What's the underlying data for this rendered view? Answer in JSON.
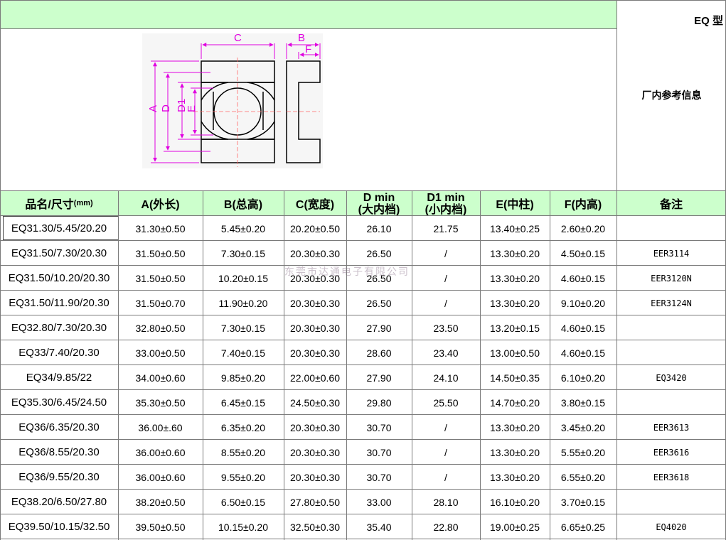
{
  "title": "EQ 型",
  "reference_info": "厂内参考信息",
  "diagram": {
    "labels": {
      "a": "A",
      "b": "B",
      "c": "C",
      "d": "D",
      "d1": "D1",
      "e": "E",
      "f": "F"
    },
    "colors": {
      "dimension": "#e000e0",
      "outline": "#000000",
      "background": "#f6f6f6",
      "centerline": "#ff6666"
    }
  },
  "columns": [
    {
      "label": "品名/尺寸",
      "unit": "(mm)"
    },
    {
      "label": "A(外长)"
    },
    {
      "label": "B(总高)"
    },
    {
      "label": "C(宽度)"
    },
    {
      "label": "D min",
      "sub": "(大内档)"
    },
    {
      "label": "D1 min",
      "sub": "(小内档)"
    },
    {
      "label": "E(中柱)"
    },
    {
      "label": "F(内高)"
    },
    {
      "label": "备注"
    }
  ],
  "rows": [
    [
      "EQ31.30/5.45/20.20",
      "31.30±0.50",
      "5.45±0.20",
      "20.20±0.50",
      "26.10",
      "21.75",
      "13.40±0.25",
      "2.60±0.20",
      ""
    ],
    [
      "EQ31.50/7.30/20.30",
      "31.50±0.50",
      "7.30±0.15",
      "20.30±0.30",
      "26.50",
      "/",
      "13.30±0.20",
      "4.50±0.15",
      "EER3114"
    ],
    [
      "EQ31.50/10.20/20.30",
      "31.50±0.50",
      "10.20±0.15",
      "20.30±0.30",
      "26.50",
      "/",
      "13.30±0.20",
      "4.60±0.15",
      "EER3120N"
    ],
    [
      "EQ31.50/11.90/20.30",
      "31.50±0.70",
      "11.90±0.20",
      "20.30±0.30",
      "26.50",
      "/",
      "13.30±0.20",
      "9.10±0.20",
      "EER3124N"
    ],
    [
      "EQ32.80/7.30/20.30",
      "32.80±0.50",
      "7.30±0.15",
      "20.30±0.30",
      "27.90",
      "23.50",
      "13.20±0.15",
      "4.60±0.15",
      ""
    ],
    [
      "EQ33/7.40/20.30",
      "33.00±0.50",
      "7.40±0.15",
      "20.30±0.30",
      "28.60",
      "23.40",
      "13.00±0.50",
      "4.60±0.15",
      ""
    ],
    [
      "EQ34/9.85/22",
      "34.00±0.60",
      "9.85±0.20",
      "22.00±0.60",
      "27.90",
      "24.10",
      "14.50±0.35",
      "6.10±0.20",
      "EQ3420"
    ],
    [
      "EQ35.30/6.45/24.50",
      "35.30±0.50",
      "6.45±0.15",
      "24.50±0.30",
      "29.80",
      "25.50",
      "14.70±0.20",
      "3.80±0.15",
      ""
    ],
    [
      "EQ36/6.35/20.30",
      "36.00±.60",
      "6.35±0.20",
      "20.30±0.30",
      "30.70",
      "/",
      "13.30±0.20",
      "3.45±0.20",
      "EER3613"
    ],
    [
      "EQ36/8.55/20.30",
      "36.00±0.60",
      "8.55±0.20",
      "20.30±0.30",
      "30.70",
      "/",
      "13.30±0.20",
      "5.55±0.20",
      "EER3616"
    ],
    [
      "EQ36/9.55/20.30",
      "36.00±0.60",
      "9.55±0.20",
      "20.30±0.30",
      "30.70",
      "/",
      "13.30±0.20",
      "6.55±0.20",
      "EER3618"
    ],
    [
      "EQ38.20/6.50/27.80",
      "38.20±0.50",
      "6.50±0.15",
      "27.80±0.50",
      "33.00",
      "28.10",
      "16.10±0.20",
      "3.70±0.15",
      ""
    ],
    [
      "EQ39.50/10.15/32.50",
      "39.50±0.50",
      "10.15±0.20",
      "32.50±0.30",
      "35.40",
      "22.80",
      "19.00±0.25",
      "6.65±0.25",
      "EQ4020"
    ]
  ],
  "watermark": "东莞市达通电子有限公司"
}
